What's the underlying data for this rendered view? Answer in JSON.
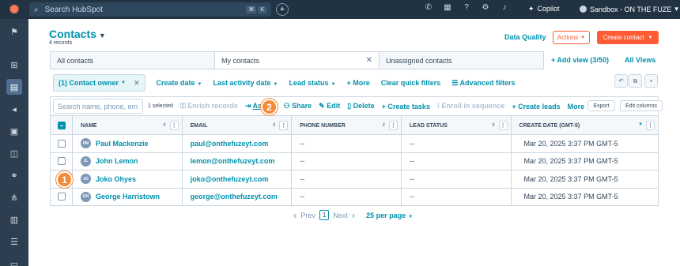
{
  "topbar": {
    "search_placeholder": "Search HubSpot",
    "kbd_cmd": "⌘",
    "kbd_k": "K",
    "copilot": "Copilot",
    "account": "Sandbox - ON THE FUZE"
  },
  "header": {
    "title": "Contacts",
    "record_count": "4 records",
    "data_quality": "Data Quality",
    "actions": "Actions",
    "create": "Create contact"
  },
  "views": {
    "tabs": [
      {
        "label": "All contacts"
      },
      {
        "label": "My contacts"
      },
      {
        "label": "Unassigned contacts"
      }
    ],
    "add_view": "+ Add view (3/50)",
    "all_views": "All Views"
  },
  "filters": {
    "owner_chip": "(1) Contact owner",
    "create_date": "Create date",
    "last_activity": "Last activity date",
    "lead_status": "Lead status",
    "more": "+ More",
    "clear": "Clear quick filters",
    "advanced": "Advanced filters"
  },
  "bulk": {
    "search_placeholder": "Search name, phone, em",
    "selected": "1 selected",
    "enrich": "Enrich records",
    "assign": "Assign",
    "share": "Share",
    "edit": "Edit",
    "delete": "Delete",
    "create_tasks": "+ Create tasks",
    "enroll": "Enroll in sequence",
    "create_leads": "+ Create leads",
    "more": "More",
    "export": "Export",
    "edit_columns": "Edit columns"
  },
  "table": {
    "headers": {
      "name": "NAME",
      "email": "EMAIL",
      "phone": "PHONE NUMBER",
      "lead_status": "LEAD STATUS",
      "create_date": "CREATE DATE (GMT-5)"
    },
    "rows": [
      {
        "initials": "PM",
        "name": "Paul Mackenzie",
        "email": "paul@onthefuzeyt.com",
        "phone": "--",
        "lead": "--",
        "date": "Mar 20, 2025 3:37 PM GMT-5"
      },
      {
        "initials": "JL",
        "name": "John Lemon",
        "email": "lemon@onthefuzeyt.com",
        "phone": "--",
        "lead": "--",
        "date": "Mar 20, 2025 3:37 PM GMT-5"
      },
      {
        "initials": "JO",
        "name": "Joko Ohyes",
        "email": "joko@onthefuzeyt.com",
        "phone": "--",
        "lead": "--",
        "date": "Mar 20, 2025 3:37 PM GMT-5"
      },
      {
        "initials": "GH",
        "name": "George Harristown",
        "email": "george@onthefuzeyt.com",
        "phone": "--",
        "lead": "--",
        "date": "Mar 20, 2025 3:37 PM GMT-5"
      }
    ]
  },
  "pager": {
    "prev": "Prev",
    "page": "1",
    "next": "Next",
    "per_page": "25 per page"
  },
  "badges": {
    "step1": "1",
    "step2": "2"
  },
  "colors": {
    "accent": "#0091ae",
    "brand": "#ff5c35",
    "topbar": "#213343",
    "badge": "#f58a3a"
  }
}
